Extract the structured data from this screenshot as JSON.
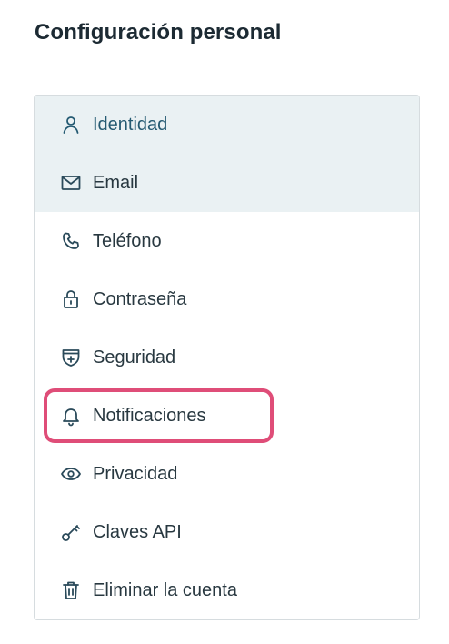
{
  "page": {
    "title": "Configuración personal"
  },
  "menu": {
    "items": [
      {
        "label": "Identidad",
        "icon": "user-icon",
        "state": "active"
      },
      {
        "label": "Email",
        "icon": "mail-icon",
        "state": "hover"
      },
      {
        "label": "Teléfono",
        "icon": "phone-icon",
        "state": "default"
      },
      {
        "label": "Contraseña",
        "icon": "lock-icon",
        "state": "default"
      },
      {
        "label": "Seguridad",
        "icon": "shield-plus-icon",
        "state": "default"
      },
      {
        "label": "Notificaciones",
        "icon": "bell-icon",
        "state": "highlighted"
      },
      {
        "label": "Privacidad",
        "icon": "eye-icon",
        "state": "default"
      },
      {
        "label": "Claves API",
        "icon": "key-icon",
        "state": "default"
      },
      {
        "label": "Eliminar la cuenta",
        "icon": "trash-icon",
        "state": "default"
      }
    ]
  },
  "colors": {
    "selected_background": "#eaf1f3",
    "active_text": "#245a72",
    "highlight_border": "#df4d78",
    "menu_border": "#d6dcdf"
  }
}
